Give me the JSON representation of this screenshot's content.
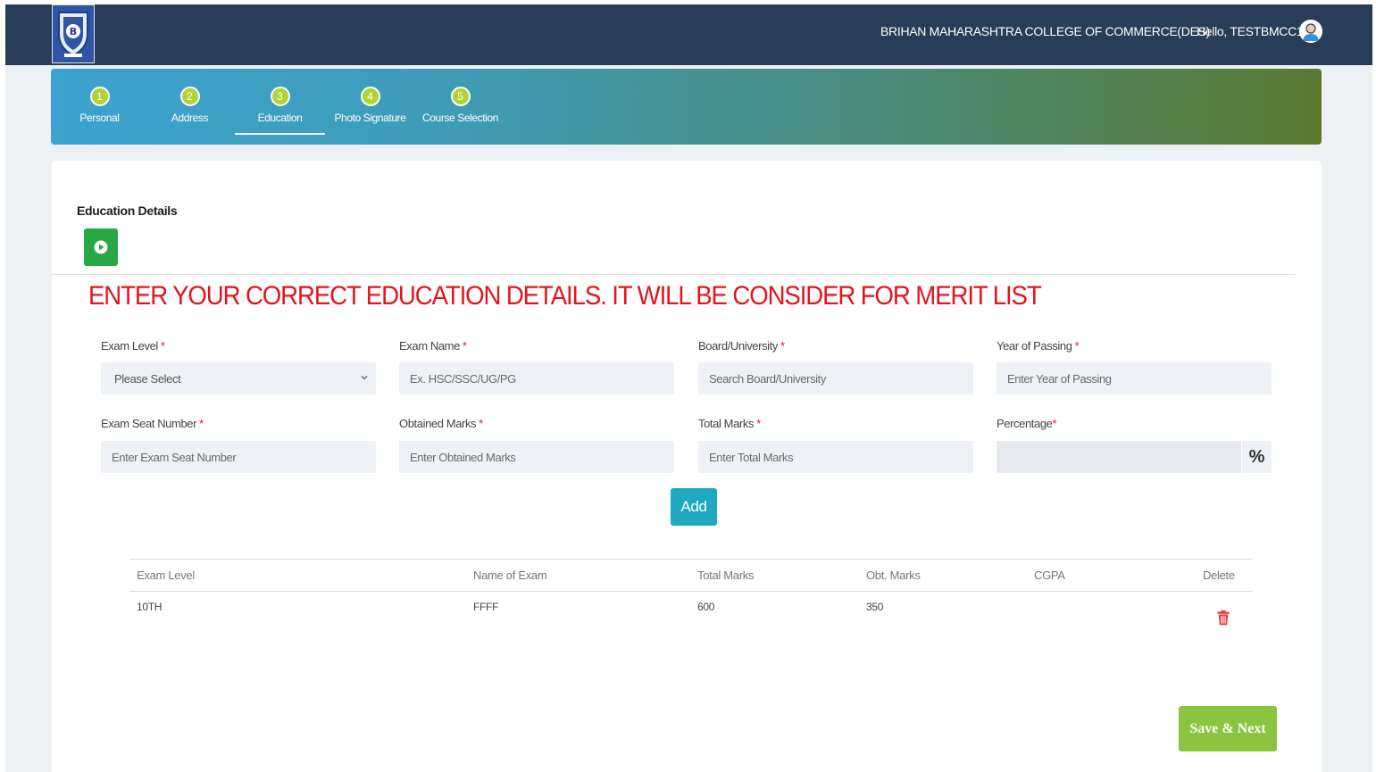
{
  "header": {
    "college": "BRIHAN MAHARASHTRA COLLEGE OF COMMERCE(DES)",
    "greeting": "Hello, TESTBMCC1",
    "logo_icon": "college-crest-logo",
    "avatar_icon": "user-avatar-icon"
  },
  "steps": [
    {
      "num": "1",
      "label": "Personal"
    },
    {
      "num": "2",
      "label": "Address"
    },
    {
      "num": "3",
      "label": "Education"
    },
    {
      "num": "4",
      "label": "Photo Signature"
    },
    {
      "num": "5",
      "label": "Course Selection"
    }
  ],
  "active_step": "Education",
  "section": {
    "title": "Education Details",
    "notice": "ENTER YOUR CORRECT EDUCATION DETAILS.  IT WILL BE CONSIDER FOR MERIT LIST"
  },
  "form": {
    "exam_level": {
      "label": "Exam Level",
      "value": "Please Select"
    },
    "exam_name": {
      "label": "Exam Name",
      "placeholder": "Ex. HSC/SSC/UG/PG"
    },
    "board": {
      "label": "Board/University",
      "placeholder": "Search Board/University"
    },
    "year": {
      "label": "Year of Passing",
      "placeholder": "Enter Year of Passing"
    },
    "seat": {
      "label": "Exam Seat Number",
      "placeholder": "Enter Exam Seat Number"
    },
    "obtained": {
      "label": "Obtained Marks",
      "placeholder": "Enter Obtained Marks"
    },
    "total": {
      "label": "Total Marks",
      "placeholder": "Enter Total Marks"
    },
    "percentage": {
      "label": "Percentage",
      "suffix": "%"
    },
    "required_mark": "*",
    "add_label": "Add"
  },
  "table": {
    "headers": [
      "Exam Level",
      "Name of Exam",
      "Total Marks",
      "Obt. Marks",
      "CGPA",
      "Delete"
    ],
    "rows": [
      {
        "exam_level": "10TH",
        "exam_name": "FFFF",
        "total": "600",
        "obtained": "350",
        "cgpa": ""
      }
    ]
  },
  "save_label": "Save & Next",
  "colors": {
    "header_bg": "#283d57",
    "accent_red": "#e3141d",
    "add_button": "#1ea9bf",
    "save_button": "#8bc53f",
    "play_button": "#28a745"
  }
}
